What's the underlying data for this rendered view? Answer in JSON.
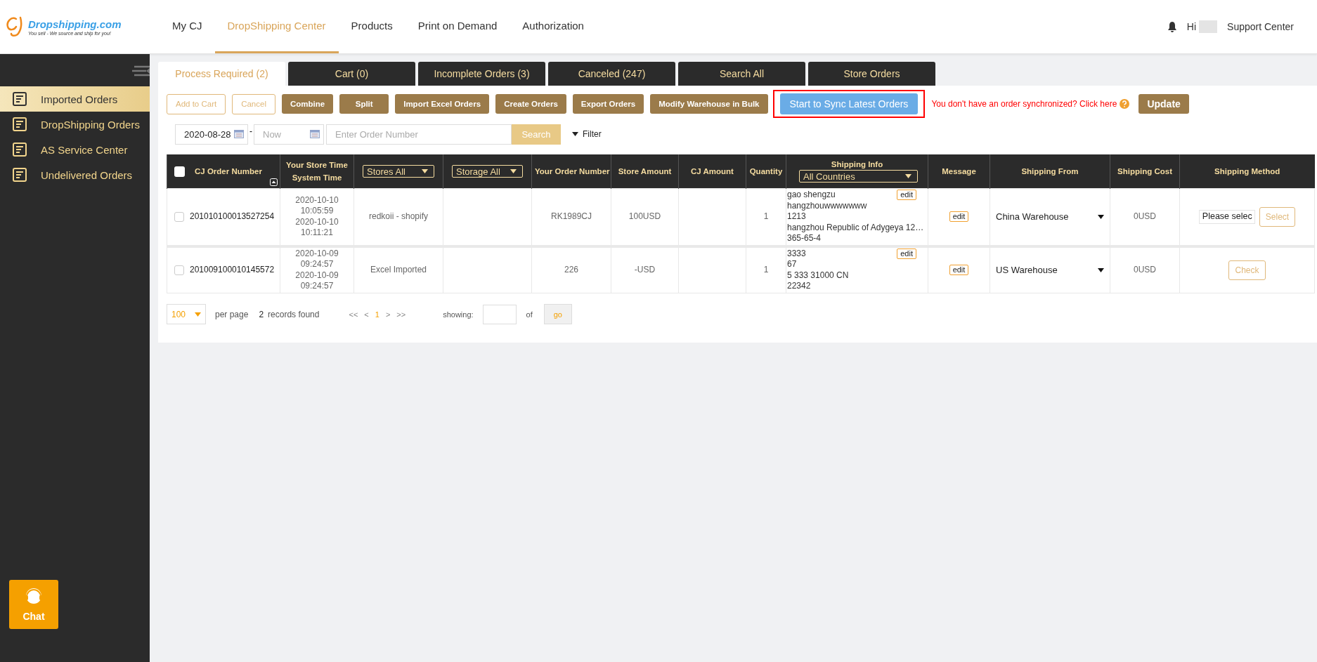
{
  "header": {
    "logo": {
      "name": "Dropshipping.com",
      "tagline": "You sell - We source and ship for you!"
    },
    "nav": [
      {
        "label": "My CJ",
        "selected": false
      },
      {
        "label": "DropShipping Center",
        "selected": true
      },
      {
        "label": "Products",
        "selected": false
      },
      {
        "label": "Print on Demand",
        "selected": false
      },
      {
        "label": "Authorization",
        "selected": false
      }
    ],
    "greeting": "Hi",
    "support": "Support Center"
  },
  "sidebar": {
    "items": [
      {
        "label": "Imported Orders",
        "selected": true
      },
      {
        "label": "DropShipping Orders",
        "selected": false
      },
      {
        "label": "AS Service Center",
        "selected": false
      },
      {
        "label": "Undelivered Orders",
        "selected": false
      }
    ],
    "chat": "Chat"
  },
  "tabs": [
    {
      "label": "Process Required (2)",
      "selected": true
    },
    {
      "label": "Cart (0)",
      "selected": false
    },
    {
      "label": "Incomplete Orders (3)",
      "selected": false
    },
    {
      "label": "Canceled (247)",
      "selected": false
    },
    {
      "label": "Search All",
      "selected": false
    },
    {
      "label": "Store Orders",
      "selected": false
    }
  ],
  "toolbar": {
    "buttons": [
      {
        "label": "Add to Cart",
        "kind": "outline"
      },
      {
        "label": "Cancel",
        "kind": "outline"
      },
      {
        "label": "Combine",
        "kind": "solid"
      },
      {
        "label": "Split",
        "kind": "solid"
      },
      {
        "label": "Import Excel Orders",
        "kind": "solid"
      },
      {
        "label": "Create Orders",
        "kind": "solid"
      },
      {
        "label": "Export Orders",
        "kind": "solid"
      },
      {
        "label": "Modify Warehouse in Bulk",
        "kind": "solid"
      },
      {
        "label": "Start to Sync Latest Orders",
        "kind": "primary",
        "highlighted": true
      }
    ],
    "hint": "You don't have an order synchronized? Click here",
    "update": "Update"
  },
  "filters": {
    "date_from": "2020-08-28",
    "separator": "-",
    "date_to_placeholder": "Now",
    "order_placeholder": "Enter Order Number",
    "search": "Search",
    "filter": "Filter"
  },
  "table": {
    "select_all_checked": false,
    "columns": [
      {
        "kind": "sort",
        "label": "CJ Order Number"
      },
      {
        "kind": "text",
        "label": "Your Store Time",
        "label2": "System Time"
      },
      {
        "kind": "select",
        "label": "Stores All"
      },
      {
        "kind": "select",
        "label": "Storage All"
      },
      {
        "kind": "text",
        "label": "Your Order Number"
      },
      {
        "kind": "text",
        "label": "Store Amount"
      },
      {
        "kind": "text",
        "label": "CJ Amount"
      },
      {
        "kind": "text",
        "label": "Quantity"
      },
      {
        "kind": "titled_select",
        "label": "Shipping Info",
        "select": "All Countries"
      },
      {
        "kind": "text",
        "label": "Message"
      },
      {
        "kind": "text",
        "label": "Shipping From"
      },
      {
        "kind": "text",
        "label": "Shipping Cost"
      },
      {
        "kind": "text",
        "label": "Shipping Method"
      }
    ],
    "rows": [
      {
        "checked": false,
        "cj_order_number": "201010100013527254",
        "store_time": [
          "2020-10-10",
          "10:05:59"
        ],
        "system_time": [
          "2020-10-10",
          "10:11:21"
        ],
        "store": "redkoii - shopify",
        "your_order_number": "RK1989CJ",
        "store_amount": "100USD",
        "quantity": "1",
        "shipping_info": [
          "gao shengzu",
          "hangzhouwwwwwww",
          "1213",
          "hangzhou Republic of Adygeya 12…",
          "365-65-4"
        ],
        "shipping_info_edit": "edit",
        "message_edit": "edit",
        "shipping_from": "China Warehouse",
        "shipping_cost": "0USD",
        "shipping_method": {
          "kind": "select",
          "value": "Please selec",
          "button": "Select"
        }
      },
      {
        "checked": false,
        "cj_order_number": "201009100010145572",
        "store_time": [
          "2020-10-09",
          "09:24:57"
        ],
        "system_time": [
          "2020-10-09",
          "09:24:57"
        ],
        "store": "Excel Imported",
        "your_order_number": "226",
        "store_amount": "-USD",
        "quantity": "1",
        "shipping_info": [
          "3333",
          "67",
          "5 333 31000 CN",
          "22342"
        ],
        "shipping_info_edit": "edit",
        "message_edit": "edit",
        "shipping_from": "US Warehouse",
        "shipping_cost": "0USD",
        "shipping_method": {
          "kind": "check",
          "button": "Check"
        }
      }
    ]
  },
  "pagination": {
    "per_page": "100",
    "per_page_label": "per page",
    "count": "2",
    "records_label": "records found",
    "pages": [
      {
        "label": "<<",
        "selected": false
      },
      {
        "label": "<",
        "selected": false
      },
      {
        "label": "1",
        "selected": true
      },
      {
        "label": ">",
        "selected": false
      },
      {
        "label": ">>",
        "selected": false
      }
    ],
    "showing": "showing:",
    "of": "of",
    "go": "go"
  }
}
